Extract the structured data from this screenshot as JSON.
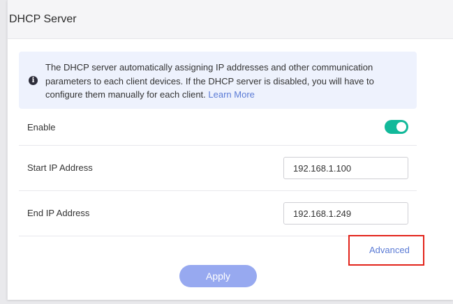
{
  "panel": {
    "title": "DHCP Server"
  },
  "info": {
    "icon": "info-circle-icon",
    "text": "The DHCP server automatically assigning IP addresses and other communication parameters to each client devices. If the DHCP server is disabled, you will have to configure them manually for each client. ",
    "learn_more": "Learn More"
  },
  "enable": {
    "label": "Enable",
    "state": "on",
    "color": "#12b99a"
  },
  "start_ip": {
    "label": "Start IP Address",
    "value": "192.168.1.100"
  },
  "end_ip": {
    "label": "End IP Address",
    "value": "192.168.1.249"
  },
  "advanced": {
    "label": "Advanced",
    "highlight_color": "#e2231a"
  },
  "apply": {
    "label": "Apply",
    "color": "#97a9f0"
  }
}
